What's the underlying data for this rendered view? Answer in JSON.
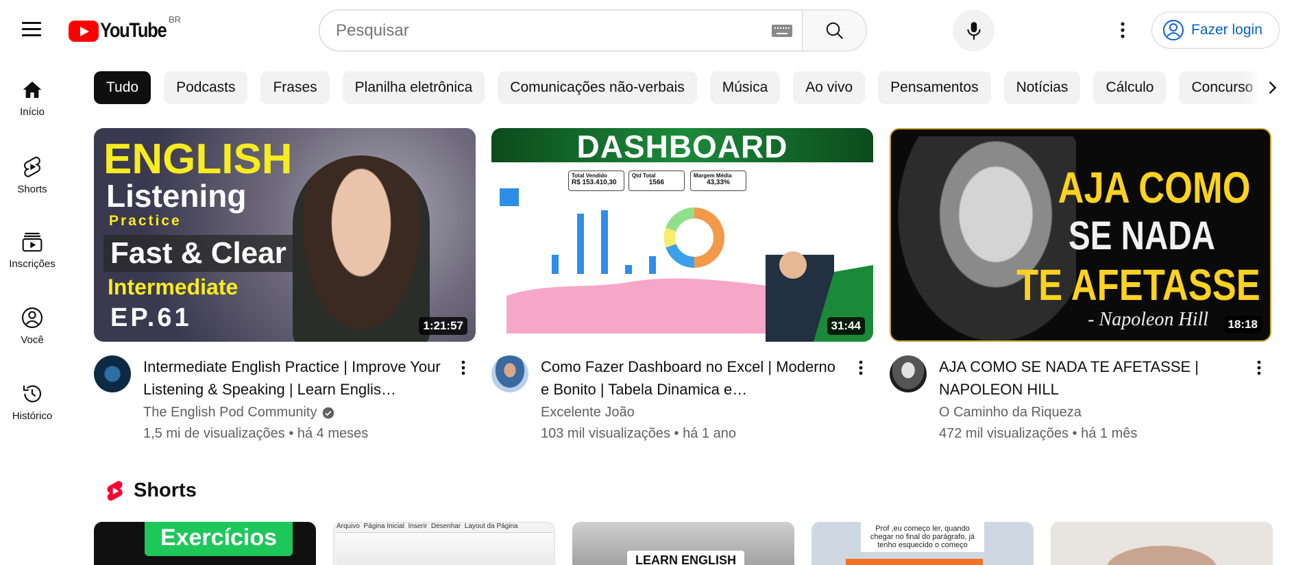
{
  "header": {
    "logo_text": "YouTube",
    "country": "BR",
    "search_placeholder": "Pesquisar",
    "login_label": "Fazer login"
  },
  "sidebar": {
    "items": [
      {
        "label": "Início",
        "icon": "home-icon"
      },
      {
        "label": "Shorts",
        "icon": "shorts-icon"
      },
      {
        "label": "Inscrições",
        "icon": "subscriptions-icon"
      },
      {
        "label": "Você",
        "icon": "user-icon"
      },
      {
        "label": "Histórico",
        "icon": "history-icon"
      }
    ]
  },
  "chips": [
    "Tudo",
    "Podcasts",
    "Frases",
    "Planilha eletrônica",
    "Comunicações não-verbais",
    "Música",
    "Ao vivo",
    "Pensamentos",
    "Notícias",
    "Cálculo",
    "Concurso"
  ],
  "videos": [
    {
      "title": "Intermediate English Practice | Improve Your Listening & Speaking | Learn Englis…",
      "channel": "The English Pod Community",
      "verified": true,
      "stats": "1,5 mi de visualizações • há 4 meses",
      "duration": "1:21:57",
      "thumb_text": {
        "l1": "ENGLISH",
        "l2": "Listening",
        "l3": "Practice",
        "l4": "Fast & Clear",
        "l5": "Intermediate",
        "l6": "EP.61"
      }
    },
    {
      "title": "Como Fazer Dashboard no Excel | Moderno e Bonito | Tabela Dinamica e…",
      "channel": "Excelente João",
      "verified": false,
      "stats": "103 mil visualizações • há 1 ano",
      "duration": "31:44",
      "thumb_text": {
        "l1": "DASHBOARD",
        "kpi1_label": "Total Vendido",
        "kpi1_value": "R$ 153.410,30",
        "kpi2_label": "Qtd Total",
        "kpi2_value": "1566",
        "kpi3_label": "Margem Média",
        "kpi3_value": "43,33%"
      }
    },
    {
      "title": "AJA COMO SE NADA TE AFETASSE | NAPOLEON HILL",
      "channel": "O Caminho da Riqueza",
      "verified": false,
      "stats": "472 mil visualizações • há 1 mês",
      "duration": "18:18",
      "thumb_text": {
        "l1": "AJA COMO",
        "l2": "SE NADA",
        "l3": "TE AFETASSE",
        "l4": "- Napoleon Hill"
      }
    }
  ],
  "shorts": {
    "title": "Shorts",
    "items": [
      {
        "text": "Exercícios"
      },
      {
        "text": "Arquivo  Página Inicial  Inserir  Desenhar  Layout da Página"
      },
      {
        "text": "LEARN ENGLISH"
      },
      {
        "text": "Prof ,eu começo ler, quando chegar no final do parágrafo, já tenho esquecido o começo"
      },
      {
        "text": ""
      }
    ]
  }
}
